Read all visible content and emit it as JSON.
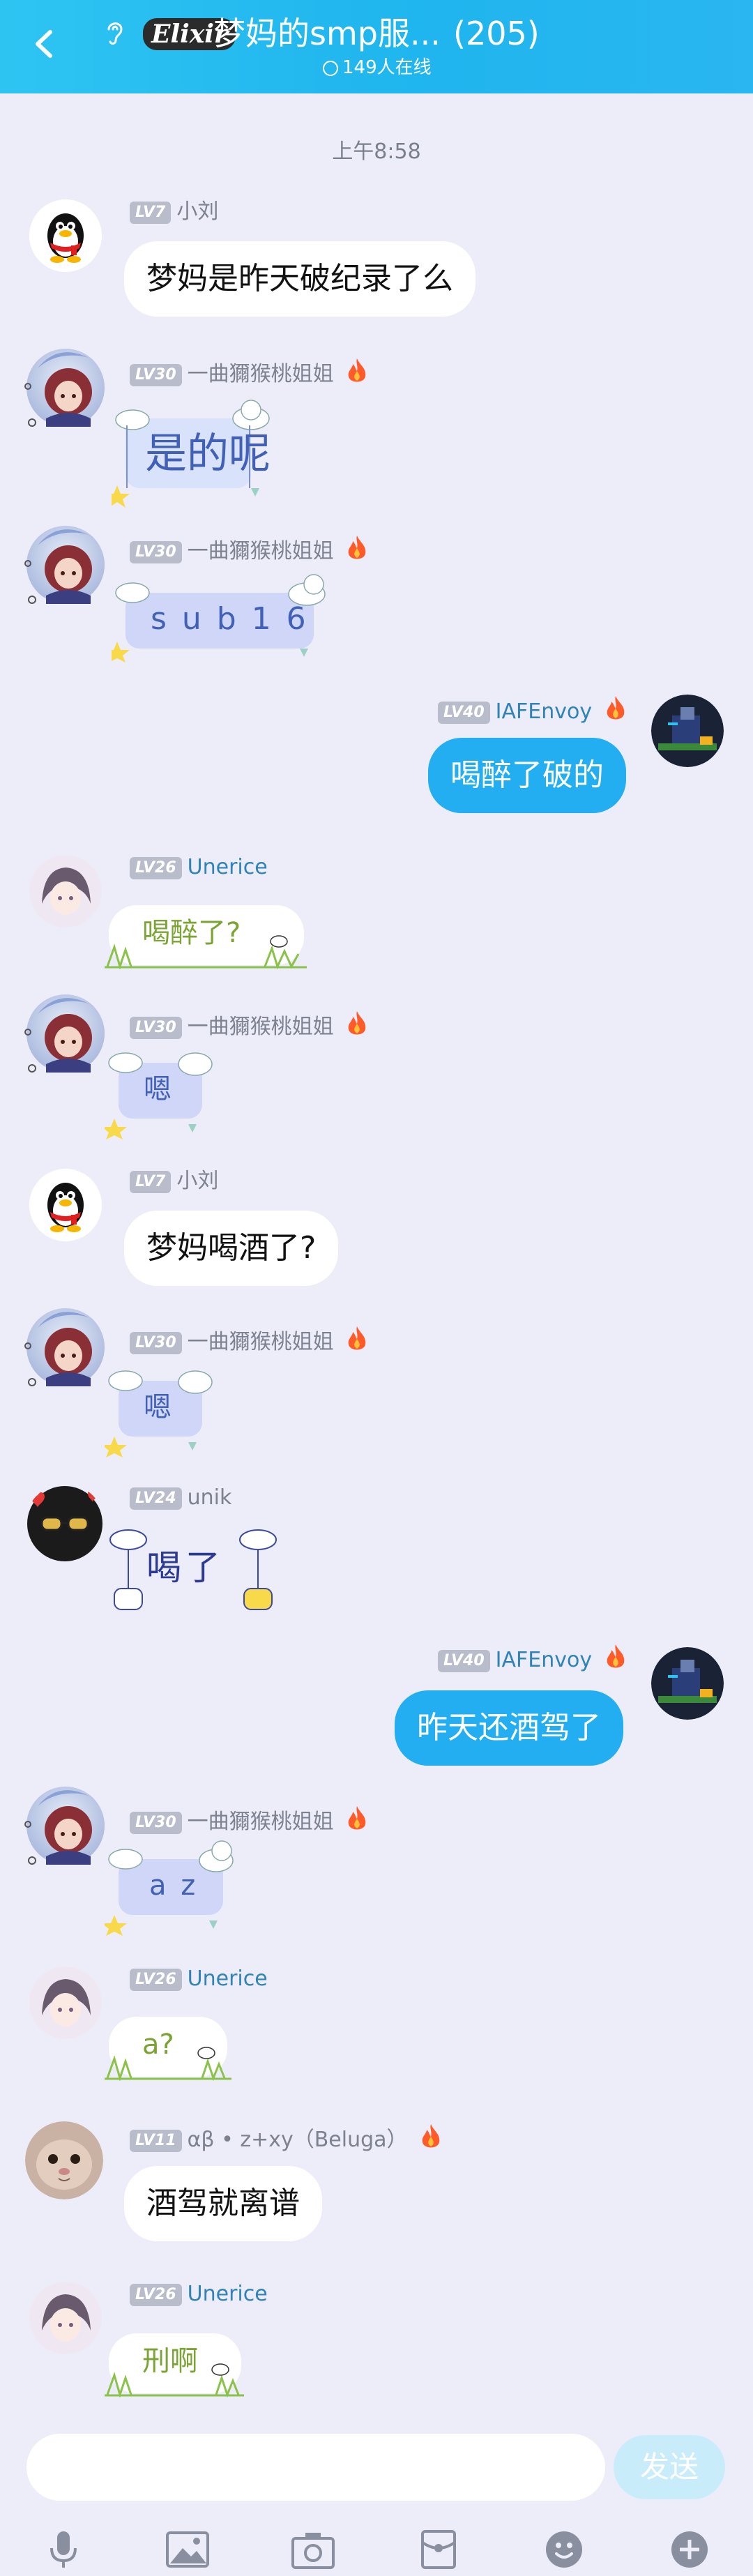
{
  "header": {
    "title": "梦妈的smp服...",
    "logo_text": "Elixir",
    "member_count": "(205)",
    "online": "149人在线"
  },
  "timestamp": "上午8:58",
  "messages": [
    {
      "level": "LV7",
      "nick": "小刘",
      "text": "梦妈是昨天破纪录了么"
    },
    {
      "level": "LV30",
      "nick": "一曲獮猴桃姐姐",
      "text": "是的呢"
    },
    {
      "level": "LV30",
      "nick": "一曲獮猴桃姐姐",
      "text": "s u b 1 6"
    },
    {
      "level": "LV40",
      "nick": "IAFEnvoy",
      "text": "喝醉了破的"
    },
    {
      "level": "LV26",
      "nick": "Unerice",
      "text": "喝醉了?"
    },
    {
      "level": "LV30",
      "nick": "一曲獮猴桃姐姐",
      "text": "嗯"
    },
    {
      "level": "LV7",
      "nick": "小刘",
      "text": "梦妈喝酒了?"
    },
    {
      "level": "LV30",
      "nick": "一曲獮猴桃姐姐",
      "text": "嗯"
    },
    {
      "level": "LV24",
      "nick": "unik",
      "text": "喝了"
    },
    {
      "level": "LV40",
      "nick": "IAFEnvoy",
      "text": "昨天还酒驾了"
    },
    {
      "level": "LV30",
      "nick": "一曲獮猴桃姐姐",
      "text": "a z"
    },
    {
      "level": "LV26",
      "nick": "Unerice",
      "text": "a?"
    },
    {
      "level": "LV11",
      "nick": "αβ • z+xy（Beluga）",
      "text": "酒驾就离谱"
    },
    {
      "level": "LV26",
      "nick": "Unerice",
      "text": "刑啊"
    }
  ],
  "input": {
    "placeholder": "",
    "send_label": "发送"
  },
  "colors": {
    "header": "#22b4ef",
    "my_bubble": "#22aef0",
    "background": "#ecedf8"
  },
  "toolbar_icons": [
    "mic-icon",
    "image-icon",
    "camera-icon",
    "red-packet-icon",
    "emoji-icon",
    "plus-icon"
  ]
}
